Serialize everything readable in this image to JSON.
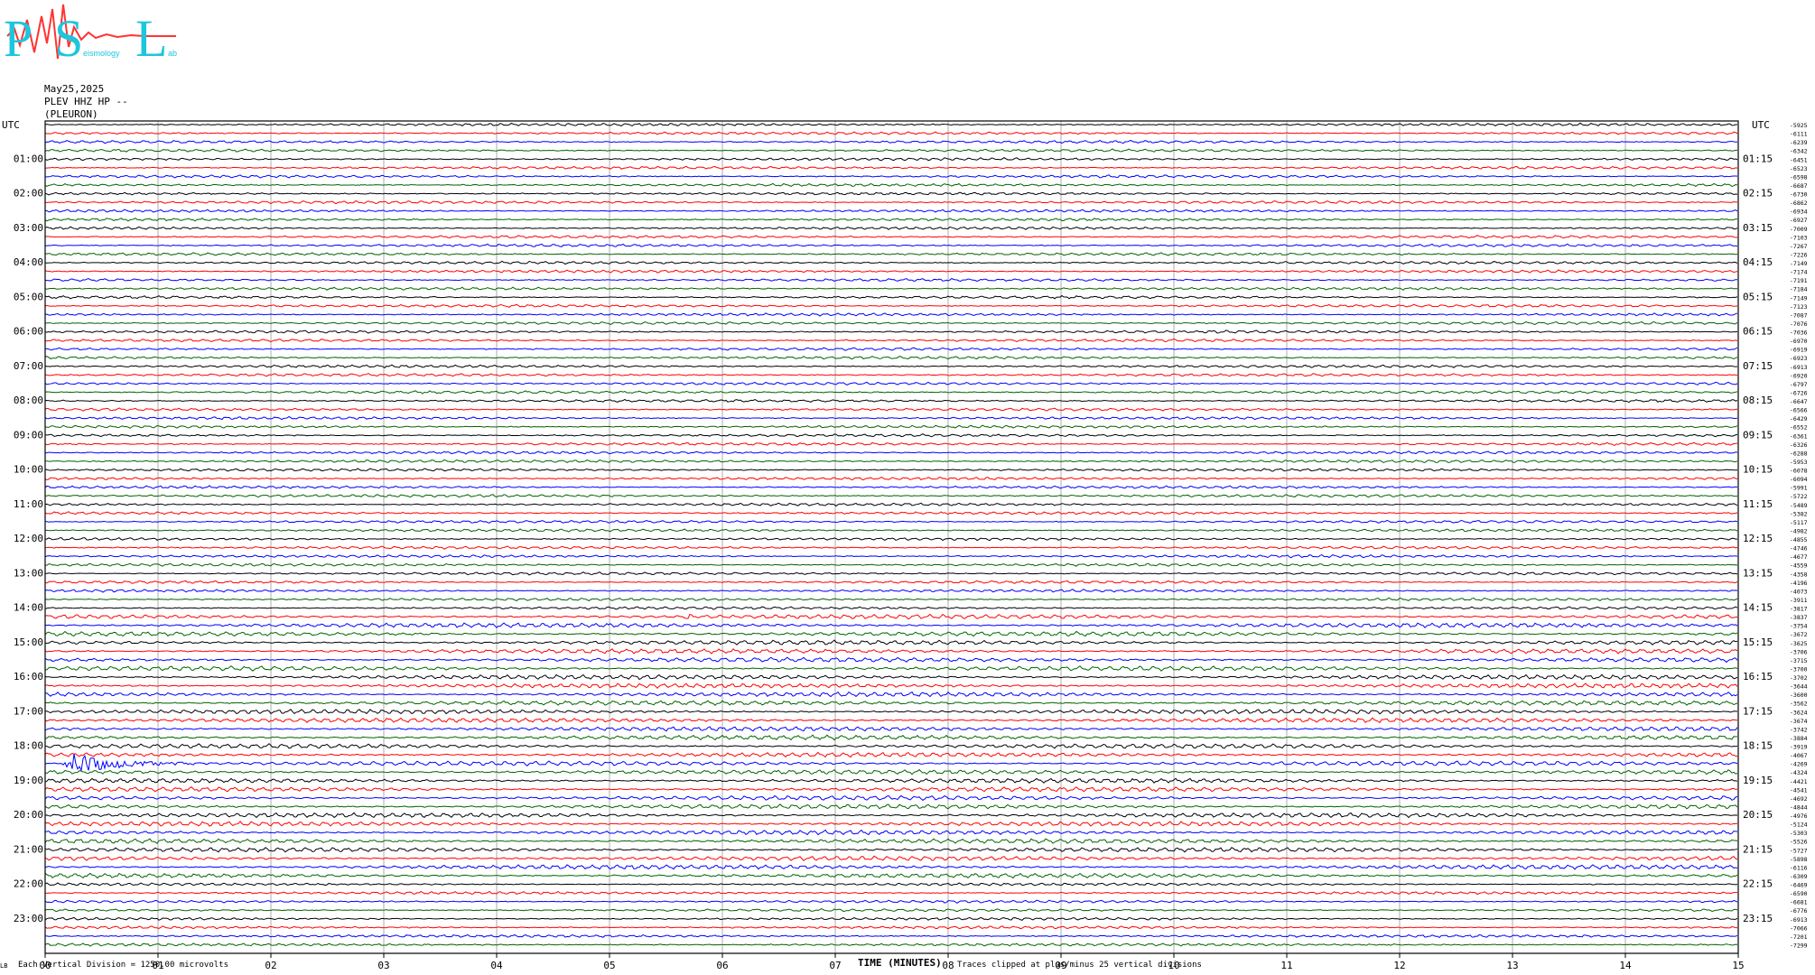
{
  "logo": {
    "letters": [
      "P",
      "S",
      "L"
    ],
    "small_words": [
      "eismology",
      "ab"
    ],
    "colors": {
      "letters": "#1ec6dc",
      "trace": "#ff3333"
    }
  },
  "header": {
    "date": "May25,2025",
    "station": "PLEV HHZ HP --",
    "site": "(PLEURON)"
  },
  "chart_data": {
    "type": "helicorder",
    "xlabel": "TIME (MINUTES)",
    "x_ticks": [
      "00",
      "01",
      "02",
      "03",
      "04",
      "05",
      "06",
      "07",
      "08",
      "09",
      "10",
      "11",
      "12",
      "13",
      "14",
      "15"
    ],
    "xlim": [
      0,
      15
    ],
    "left_axis_title": "UTC",
    "right_axis_title": "UTC",
    "left_hour_labels": [
      "01:00",
      "02:00",
      "03:00",
      "04:00",
      "05:00",
      "06:00",
      "07:00",
      "08:00",
      "09:00",
      "10:00",
      "11:00",
      "12:00",
      "13:00",
      "14:00",
      "15:00",
      "16:00",
      "17:00",
      "18:00",
      "19:00",
      "20:00",
      "21:00",
      "22:00",
      "23:00"
    ],
    "right_hour_labels": [
      "01:15",
      "02:15",
      "03:15",
      "04:15",
      "05:15",
      "06:15",
      "07:15",
      "08:15",
      "09:15",
      "10:15",
      "11:15",
      "12:15",
      "13:15",
      "14:15",
      "15:15",
      "16:15",
      "17:15",
      "18:15",
      "19:15",
      "20:15",
      "21:15",
      "22:15",
      "23:15"
    ],
    "trace_colors": [
      "#000000",
      "#ff0000",
      "#0000ff",
      "#006400"
    ],
    "traces_per_hour": 4,
    "trace_count": 96,
    "trace_offsets": [
      "-5925",
      "-6111",
      "-6239",
      "-6342",
      "-6451",
      "-6523",
      "-6598",
      "-6687",
      "-6730",
      "-6862",
      "-6934",
      "-6927",
      "-7009",
      "-7103",
      "-7267",
      "-7226",
      "-7149",
      "-7174",
      "-7191",
      "-7184",
      "-7149",
      "-7123",
      "-7087",
      "-7076",
      "-7036",
      "-6970",
      "-6919",
      "-6923",
      "-6913",
      "-6920",
      "-6797",
      "-6726",
      "-6647",
      "-6566",
      "-6429",
      "-6552",
      "-6361",
      "-6326",
      "-6288",
      "-5953",
      "-6078",
      "-6094",
      "-5991",
      "-5722",
      "-5489",
      "-5382",
      "-5117",
      "-4982",
      "-4855",
      "-4746",
      "-4677",
      "-4559",
      "-4358",
      "-4196",
      "-4073",
      "-3911",
      "-3817",
      "-3837",
      "-3754",
      "-3672",
      "-3625",
      "-3706",
      "-3715",
      "-3700",
      "-3702",
      "-3644",
      "-3600",
      "-3562",
      "-3624",
      "-3674",
      "-3742",
      "-3884",
      "-3919",
      "-4067",
      "-4269",
      "-4324",
      "-4421",
      "-4541",
      "-4692",
      "-4844",
      "-4976",
      "-5124",
      "-5303",
      "-5526",
      "-5727",
      "-5898",
      "-6116",
      "-6309",
      "-6469",
      "-6590",
      "-6681",
      "-6776",
      "-6913",
      "-7066",
      "-7201",
      "-7299"
    ],
    "events": [
      {
        "trace": 74,
        "start_min": 0.15,
        "end_min": 1.45,
        "amplitude": "large"
      },
      {
        "trace": 57,
        "start_min": 5.65,
        "end_min": 5.85,
        "amplitude": "small"
      }
    ]
  },
  "footer": {
    "left_mark": "LB",
    "vertical_division": "Each Vertical Division = 1250.00 microvolts",
    "clip_note": "Traces clipped at plus/minus 25 vertical divisions"
  }
}
